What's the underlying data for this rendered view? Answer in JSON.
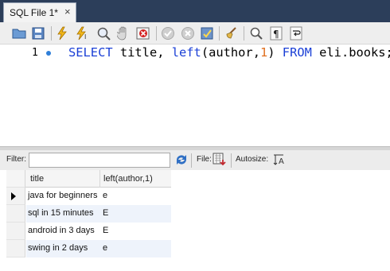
{
  "tab": {
    "label": "SQL File 1*",
    "close": "×"
  },
  "toolbar": {
    "icons": [
      "open-folder-icon",
      "save-icon",
      "execute-icon",
      "execute-current-icon",
      "explain-icon",
      "stop-icon",
      "toggle-error-icon",
      "commit-icon",
      "rollback-icon",
      "autocommit-icon",
      "beautify-icon",
      "find-icon",
      "invisible-chars-icon",
      "wrap-icon"
    ]
  },
  "editor": {
    "line_number": "1",
    "tokens": [
      {
        "text": "SELECT",
        "kind": "kw"
      },
      {
        "text": " title, ",
        "kind": "plain"
      },
      {
        "text": "left",
        "kind": "kw"
      },
      {
        "text": "(author,",
        "kind": "plain"
      },
      {
        "text": "1",
        "kind": "num"
      },
      {
        "text": ") ",
        "kind": "plain"
      },
      {
        "text": "FROM",
        "kind": "kw"
      },
      {
        "text": " eli.books;",
        "kind": "plain"
      }
    ]
  },
  "result_toolbar": {
    "filter_label": "Filter:",
    "filter_value": "",
    "file_label": "File:",
    "autosize_label": "Autosize:"
  },
  "grid": {
    "columns": [
      "title",
      "left(author,1)"
    ],
    "rows": [
      [
        "java for beginners",
        "e"
      ],
      [
        "sql in 15 minutes",
        "E"
      ],
      [
        "android in 3 days",
        "E"
      ],
      [
        "swing in 2 days",
        "e"
      ]
    ],
    "current_row": 0
  },
  "colors": {
    "tab_strip": "#2c3e5a",
    "keyword": "#1a3fd6",
    "number": "#e07020",
    "row_alt": "#eef3fb"
  }
}
